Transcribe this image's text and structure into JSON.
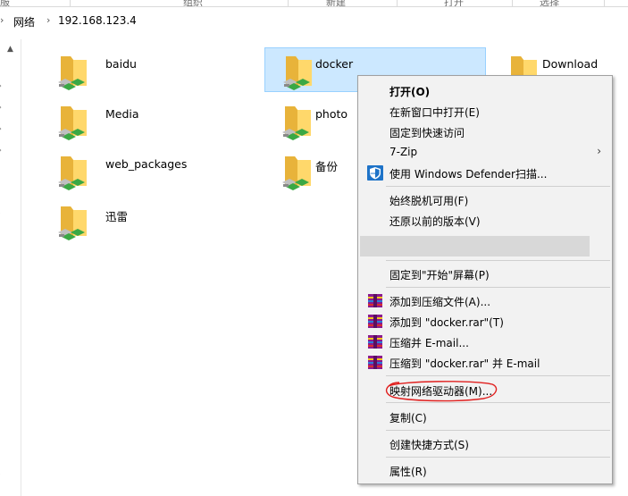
{
  "ribbon": {
    "labels": [
      "服",
      "组织",
      "新建",
      "打开",
      "选择"
    ]
  },
  "address": {
    "parts": [
      "网络",
      "192.168.123.4"
    ]
  },
  "nav": {
    "fragments": [
      ")",
      ")"
    ]
  },
  "files": [
    {
      "name": "baidu"
    },
    {
      "name": "docker"
    },
    {
      "name": "Download"
    },
    {
      "name": "Media"
    },
    {
      "name": "photo"
    },
    {
      "name": "web_packages"
    },
    {
      "name": "备份"
    },
    {
      "name": "迅雷"
    }
  ],
  "menu": {
    "open": "打开(O)",
    "open_new_window": "在新窗口中打开(E)",
    "pin_quick_access": "固定到快速访问",
    "zip7": "7-Zip",
    "defender": "使用 Windows Defender扫描...",
    "always_offline": "始终脱机可用(F)",
    "restore_versions": "还原以前的版本(V)",
    "pin_start": "固定到\"开始\"屏幕(P)",
    "add_archive": "添加到压缩文件(A)...",
    "add_docker_rar": "添加到 \"docker.rar\"(T)",
    "compress_email": "压缩并 E-mail...",
    "compress_docker_email": "压缩到 \"docker.rar\" 并 E-mail",
    "map_drive": "映射网络驱动器(M)...",
    "copy": "复制(C)",
    "create_shortcut": "创建快捷方式(S)",
    "properties": "属性(R)"
  },
  "colors": {
    "selection_bg": "#cce8ff",
    "folder_yellow": "#f4c64e",
    "network_green": "#3aa845",
    "annotation_red": "#e0201f"
  },
  "icons": {
    "folder": "network-folder-icon",
    "rar": "winrar-icon",
    "defender": "shield-icon"
  }
}
